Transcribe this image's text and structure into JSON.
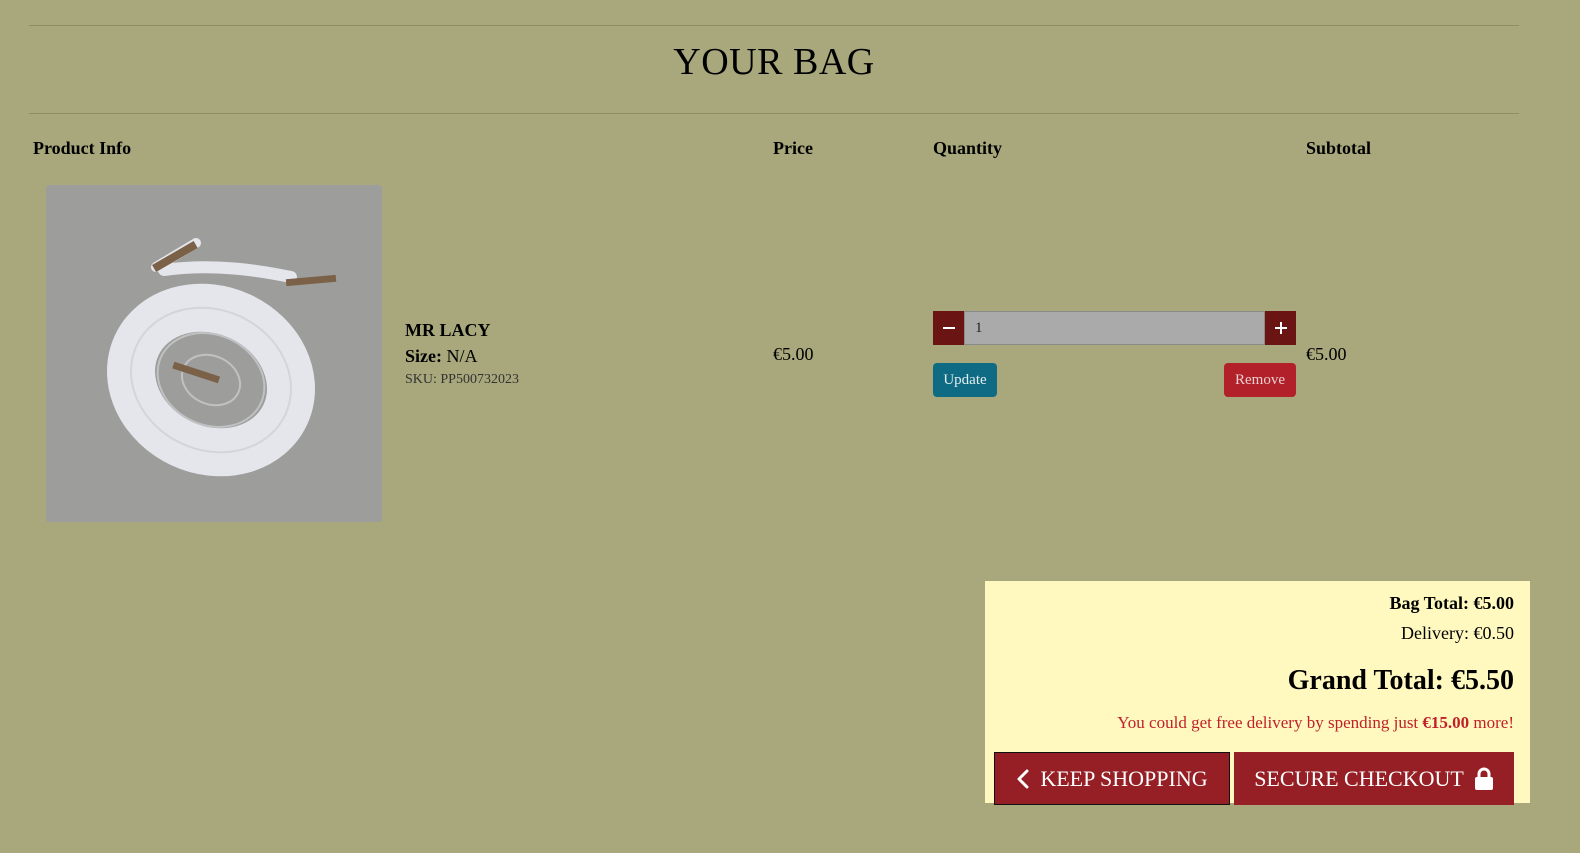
{
  "page": {
    "title": "YOUR BAG"
  },
  "table": {
    "headers": {
      "product_info": "Product Info",
      "price": "Price",
      "quantity": "Quantity",
      "subtotal": "Subtotal"
    }
  },
  "item": {
    "name": "MR LACY",
    "size_label": "Size:",
    "size_value": "N/A",
    "sku": "SKU: PP500732023",
    "price": "€5.00",
    "quantity": "1",
    "subtotal": "€5.00",
    "update_label": "Update",
    "remove_label": "Remove",
    "decrement_icon": "minus-icon",
    "increment_icon": "plus-icon"
  },
  "summary": {
    "bag_total": "Bag Total: €5.00",
    "delivery": "Delivery: €0.50",
    "grand_total": "Grand Total: €5.50",
    "free_delivery_prefix": "You could get free delivery by spending just",
    "free_delivery_amount": "€15.00",
    "free_delivery_suffix": "more!",
    "keep_shopping_label": "KEEP SHOPPING",
    "secure_checkout_label": "SECURE CHECKOUT"
  },
  "colors": {
    "background": "#a8a87c",
    "button_dark_red": "#951f24",
    "update_blue": "#0e6b83",
    "remove_red": "#b2202a",
    "summary_bg": "#fff9c0",
    "free_delivery_text": "#c0202a"
  }
}
